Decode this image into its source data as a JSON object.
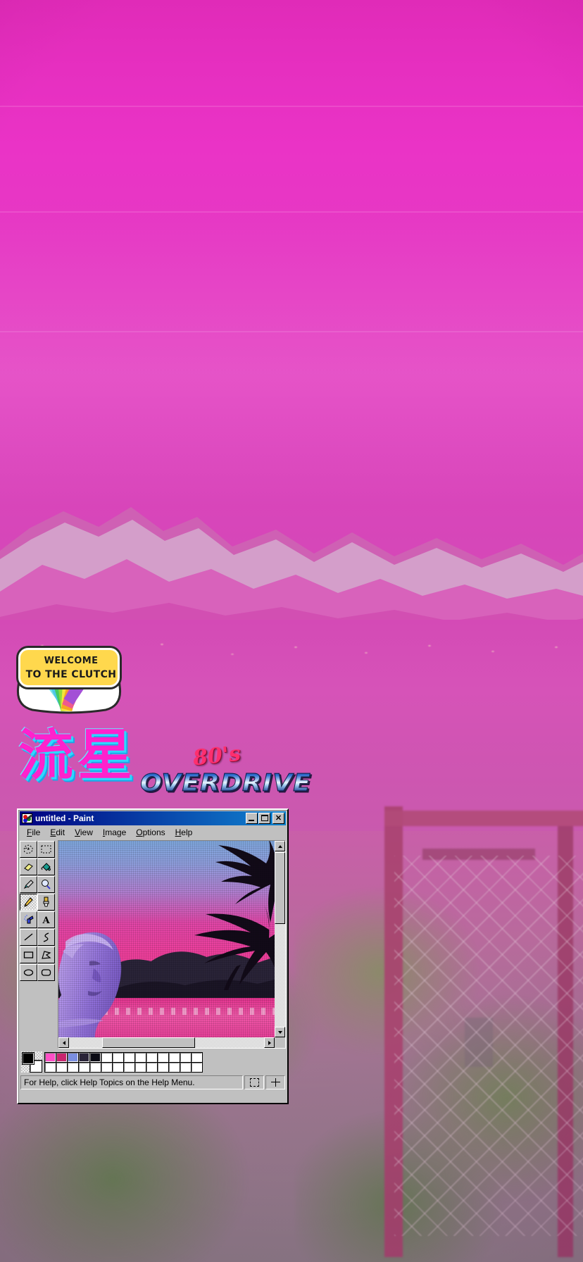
{
  "wallpaper": {
    "theme": "vaporwave-mountain-lake",
    "sky_color": "#e62fc0",
    "lake_color": "#d44ab6",
    "ground_color": "#9e7590"
  },
  "sticker": {
    "name": "welcome-to-the-clutch-sticker",
    "line1": "WELCOME",
    "line2": "TO THE CLUTCH",
    "plate_color": "#ffd84d",
    "rainbow_colors": [
      "#7de3e8",
      "#4fc6e8",
      "#44c95f",
      "#8fd93e",
      "#f2e63b",
      "#f5a623",
      "#ef5a8c",
      "#a34fd6"
    ]
  },
  "kanji_logo": {
    "text": "流星",
    "meaning": "meteor",
    "fill_color": "#ff22cc",
    "shadow_color": "#2fd8ff"
  },
  "overdrive_logo": {
    "top_text": "80's",
    "main_text": "OVERDRIVE",
    "top_color": "#ff2f6e",
    "main_color": "#2f6fd0"
  },
  "paint_window": {
    "title": "untitled - Paint",
    "icon": "paint-palette-icon",
    "titlebar_color": "#000080",
    "controls": [
      {
        "name": "minimize",
        "glyph": "minimize"
      },
      {
        "name": "maximize",
        "glyph": "maximize"
      },
      {
        "name": "close",
        "glyph": "✕"
      }
    ],
    "menus": [
      {
        "label": "File",
        "accel": "F"
      },
      {
        "label": "Edit",
        "accel": "E"
      },
      {
        "label": "View",
        "accel": "V"
      },
      {
        "label": "Image",
        "accel": "I"
      },
      {
        "label": "Options",
        "accel": "O"
      },
      {
        "label": "Help",
        "accel": "H"
      }
    ],
    "tools": [
      {
        "name": "free-form-select-tool",
        "label": "Free-Form Select",
        "selected": false
      },
      {
        "name": "select-tool",
        "label": "Select",
        "selected": false
      },
      {
        "name": "eraser-tool",
        "label": "Eraser/Color Eraser",
        "selected": false
      },
      {
        "name": "fill-with-color-tool",
        "label": "Fill With Color",
        "selected": false
      },
      {
        "name": "pick-color-tool",
        "label": "Pick Color",
        "selected": false
      },
      {
        "name": "magnifier-tool",
        "label": "Magnifier",
        "selected": false
      },
      {
        "name": "pencil-tool",
        "label": "Pencil",
        "selected": true
      },
      {
        "name": "brush-tool",
        "label": "Brush",
        "selected": false
      },
      {
        "name": "airbrush-tool",
        "label": "Airbrush",
        "selected": false
      },
      {
        "name": "text-tool",
        "label": "Text",
        "selected": false
      },
      {
        "name": "line-tool",
        "label": "Line",
        "selected": false
      },
      {
        "name": "curve-tool",
        "label": "Curve",
        "selected": false
      },
      {
        "name": "rectangle-tool",
        "label": "Rectangle",
        "selected": false
      },
      {
        "name": "polygon-tool",
        "label": "Polygon",
        "selected": false
      },
      {
        "name": "ellipse-tool",
        "label": "Ellipse",
        "selected": false
      },
      {
        "name": "rounded-rectangle-tool",
        "label": "Rounded Rectangle",
        "selected": false
      }
    ],
    "canvas": {
      "name": "paint-canvas",
      "artwork": "vaporwave sunset with palm trees, mountains, ocean and a purple classical marble bust",
      "sky_top_color": "#7fa7dd",
      "sky_bottom_color": "#ef3f9c",
      "mountain_color": "#2a1f3a",
      "water_color": "#e4338f",
      "bust_color": "#a07de0",
      "palm_color": "#120a18"
    },
    "scrollbars": {
      "vertical": {
        "name": "vertical-scrollbar",
        "thumb_top_pct": 8,
        "thumb_height_pct": 36
      },
      "horizontal": {
        "name": "horizontal-scrollbar",
        "thumb_left_pct": 22,
        "thumb_width_pct": 52
      }
    },
    "palette": {
      "foreground": "#000000",
      "background": "#ffffff",
      "row1": [
        "#ff4fc6",
        "#c9266e",
        "#7b8fe0",
        "#2a2438",
        "#0b0b14",
        "#ffffff",
        "#ffffff",
        "#ffffff",
        "#ffffff",
        "#ffffff",
        "#ffffff",
        "#ffffff",
        "#ffffff",
        "#ffffff"
      ],
      "row2": [
        "#ffffff",
        "#ffffff",
        "#ffffff",
        "#ffffff",
        "#ffffff",
        "#ffffff",
        "#ffffff",
        "#ffffff",
        "#ffffff",
        "#ffffff",
        "#ffffff",
        "#ffffff",
        "#ffffff",
        "#ffffff"
      ]
    },
    "status": {
      "help_text": "For Help, click Help Topics on the Help Menu.",
      "pane2_icon": "selection-size-icon",
      "pane3_icon": "cursor-position-icon"
    }
  }
}
